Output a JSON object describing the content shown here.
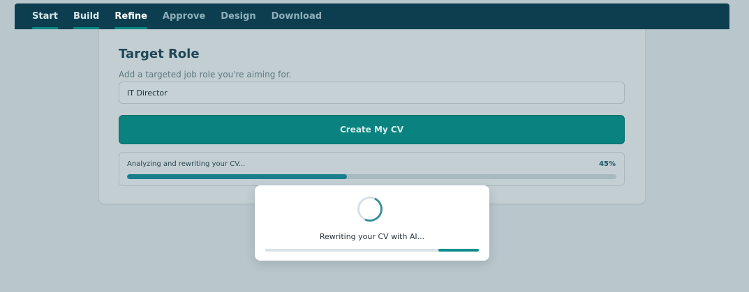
{
  "nav": {
    "tabs": [
      {
        "label": "Start",
        "state": "done"
      },
      {
        "label": "Build",
        "state": "done"
      },
      {
        "label": "Refine",
        "state": "active"
      },
      {
        "label": "Approve",
        "state": "pending"
      },
      {
        "label": "Design",
        "state": "pending"
      },
      {
        "label": "Download",
        "state": "pending"
      }
    ]
  },
  "card": {
    "title": "Target Role",
    "help_text": "Add a targeted job role you're aiming for.",
    "role_input_value": "IT Director",
    "create_button_label": "Create My CV"
  },
  "progress": {
    "label": "Analyzing and rewriting your CV...",
    "percent_text": "45%",
    "percent_value": 45
  },
  "modal": {
    "message": "Rewriting your CV with AI...",
    "bar_fill_fraction": 0.19
  },
  "colors": {
    "accent": "#0a827f",
    "nav_background": "#0d3e4f",
    "page_background": "#b9c6cc"
  },
  "icons": {
    "spinner": "loading-spinner-icon"
  }
}
